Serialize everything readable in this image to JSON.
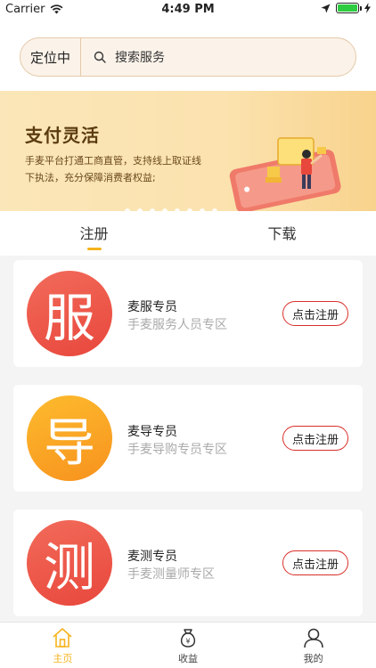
{
  "status_bar": {
    "carrier": "Carrier",
    "time": "4:49 PM"
  },
  "header": {
    "location_label": "定位中",
    "search_placeholder": "搜索服务"
  },
  "banner": {
    "title": "支付灵活",
    "line1": "手麦平台打通工商直管，支持线上取证线",
    "line2": "下执法，充分保障消费者权益;"
  },
  "tabs": [
    {
      "label": "注册",
      "active": true
    },
    {
      "label": "下载",
      "active": false
    }
  ],
  "cards": [
    {
      "badge_char": "服",
      "badge_color": "#ee5a48",
      "name": "麦服专员",
      "desc": "手麦服务人员专区",
      "button": "点击注册"
    },
    {
      "badge_char": "导",
      "badge_color": "#f9a826",
      "name": "麦导专员",
      "desc": "手麦导购专员专区",
      "button": "点击注册"
    },
    {
      "badge_char": "测",
      "badge_color": "#ee5a48",
      "name": "麦测专员",
      "desc": "手麦测量师专区",
      "button": "点击注册"
    }
  ],
  "tabbar": [
    {
      "label": "主页",
      "icon": "home-icon",
      "active": true
    },
    {
      "label": "收益",
      "icon": "money-bag-icon",
      "active": false
    },
    {
      "label": "我的",
      "icon": "user-icon",
      "active": false
    }
  ],
  "colors": {
    "accent": "#f5b41e",
    "button_border": "#d9302a"
  }
}
